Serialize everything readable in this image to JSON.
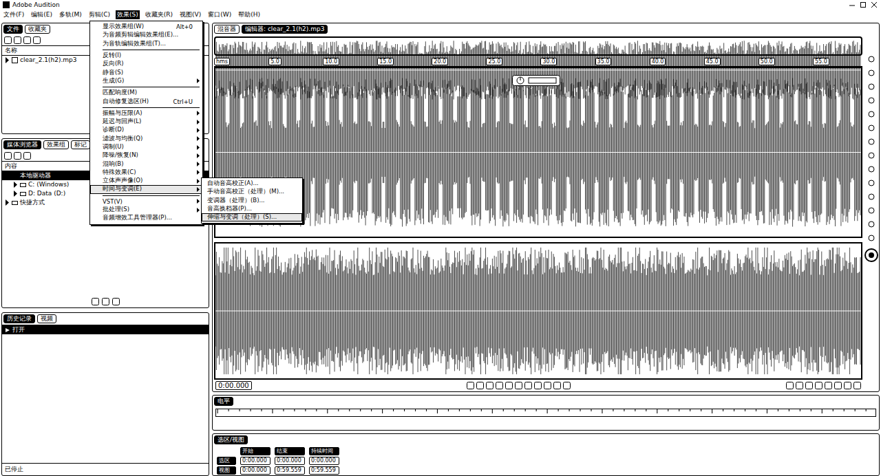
{
  "window": {
    "title": "Adobe Audition"
  },
  "menu_bar": [
    {
      "label": "文件(F)",
      "selected": false
    },
    {
      "label": "编辑(E)",
      "selected": false
    },
    {
      "label": "多轨(M)",
      "selected": false
    },
    {
      "label": "剪辑(C)",
      "selected": false
    },
    {
      "label": "效果(S)",
      "selected": true
    },
    {
      "label": "收藏夹(R)",
      "selected": false
    },
    {
      "label": "视图(V)",
      "selected": false
    },
    {
      "label": "窗口(W)",
      "selected": false
    },
    {
      "label": "帮助(H)",
      "selected": false
    }
  ],
  "effects_menu": [
    {
      "kind": "item",
      "label": "显示效果组(W)",
      "shortcut": "Alt+0",
      "submenu": false,
      "selected": false
    },
    {
      "kind": "item",
      "label": "为音频剪辑编辑效果组(E)...",
      "submenu": false,
      "selected": false
    },
    {
      "kind": "item",
      "label": "为音轨编辑效果组(T)...",
      "submenu": false,
      "selected": false
    },
    {
      "kind": "separator"
    },
    {
      "kind": "item",
      "label": "反转(I)",
      "submenu": false,
      "selected": false
    },
    {
      "kind": "item",
      "label": "反向(R)",
      "submenu": false,
      "selected": false
    },
    {
      "kind": "item",
      "label": "静音(S)",
      "submenu": false,
      "selected": false
    },
    {
      "kind": "item",
      "label": "生成(G)",
      "submenu": true,
      "selected": false
    },
    {
      "kind": "separator"
    },
    {
      "kind": "item",
      "label": "匹配响度(M)",
      "submenu": false,
      "selected": false
    },
    {
      "kind": "item",
      "label": "自动修复选区(H)",
      "shortcut": "Ctrl+U",
      "submenu": false,
      "selected": false
    },
    {
      "kind": "separator"
    },
    {
      "kind": "item",
      "label": "振幅与压限(A)",
      "submenu": true,
      "selected": false
    },
    {
      "kind": "item",
      "label": "延迟与回声(L)",
      "submenu": true,
      "selected": false
    },
    {
      "kind": "item",
      "label": "诊断(D)",
      "submenu": true,
      "selected": false
    },
    {
      "kind": "item",
      "label": "滤波与均衡(Q)",
      "submenu": true,
      "selected": false
    },
    {
      "kind": "item",
      "label": "调制(U)",
      "submenu": true,
      "selected": false
    },
    {
      "kind": "item",
      "label": "降噪/恢复(N)",
      "submenu": true,
      "selected": false
    },
    {
      "kind": "item",
      "label": "混响(B)",
      "submenu": true,
      "selected": false
    },
    {
      "kind": "item",
      "label": "特殊效果(C)",
      "submenu": true,
      "selected": false
    },
    {
      "kind": "item",
      "label": "立体声声像(O)",
      "submenu": true,
      "selected": false
    },
    {
      "kind": "item",
      "label": "时间与变调(E)",
      "submenu": true,
      "selected": true
    },
    {
      "kind": "separator"
    },
    {
      "kind": "item",
      "label": "VST(V)",
      "submenu": true,
      "selected": false
    },
    {
      "kind": "item",
      "label": "批处理(S)",
      "submenu": true,
      "selected": false
    },
    {
      "kind": "item",
      "label": "音频增效工具管理器(P)...",
      "submenu": false,
      "selected": false
    }
  ],
  "time_pitch_submenu": [
    {
      "label": "自动音高校正(A)...",
      "selected": false
    },
    {
      "label": "手动音高校正（处理）(M)...",
      "selected": false
    },
    {
      "label": "变调器（处理）(B)...",
      "selected": false
    },
    {
      "label": "音高换档器(P)...",
      "selected": false
    },
    {
      "label": "伸缩与变调（处理）(S)...",
      "selected": true
    }
  ],
  "files_panel": {
    "tabs": [
      {
        "label": "文件",
        "selected": true
      },
      {
        "label": "收藏夹",
        "selected": false
      }
    ],
    "column": "名称",
    "items": [
      {
        "name": "clear_2.1(h2).mp3",
        "selected": false
      }
    ]
  },
  "media_panel": {
    "tabs": [
      {
        "label": "媒体浏览器",
        "selected": true
      },
      {
        "label": "效果组",
        "selected": false
      },
      {
        "label": "标记",
        "selected": false
      }
    ],
    "column": "内容",
    "tree": [
      {
        "label": "本地驱动器",
        "expanded": true,
        "selected": true,
        "children": [
          {
            "label": "C: (Windows)",
            "expanded": false,
            "selected": false
          },
          {
            "label": "D: Data (D:)",
            "expanded": false,
            "selected": false
          }
        ]
      },
      {
        "label": "快捷方式",
        "expanded": false,
        "selected": false,
        "children": []
      }
    ]
  },
  "history_panel": {
    "tabs": [
      {
        "label": "历史记录",
        "selected": true
      },
      {
        "label": "视频",
        "selected": false
      }
    ],
    "items": [
      {
        "label": "打开",
        "selected": true
      }
    ]
  },
  "editor": {
    "tabs": [
      {
        "label": "混音器",
        "selected": false
      },
      {
        "label": "编辑器: clear_2.1(h2).mp3",
        "selected": true
      }
    ],
    "ruler": [
      "hms",
      "5.0",
      "10.0",
      "15.0",
      "20.0",
      "25.0",
      "30.0",
      "35.0",
      "40.0",
      "45.0",
      "50.0",
      "55.0"
    ],
    "time": "0:00.000"
  },
  "levels_panel": {
    "title": "电平"
  },
  "selection_panel": {
    "title": "选区/视图",
    "columns": [
      "开始",
      "结束",
      "持续时间"
    ],
    "rows": [
      {
        "label": "选区",
        "values": [
          "0:00.000",
          "0:00.000",
          "0:00.000"
        ]
      },
      {
        "label": "视图",
        "values": [
          "0:00.000",
          "0:59.559",
          "0:59.559"
        ]
      }
    ]
  },
  "status_bar": {
    "text": "已停止"
  }
}
